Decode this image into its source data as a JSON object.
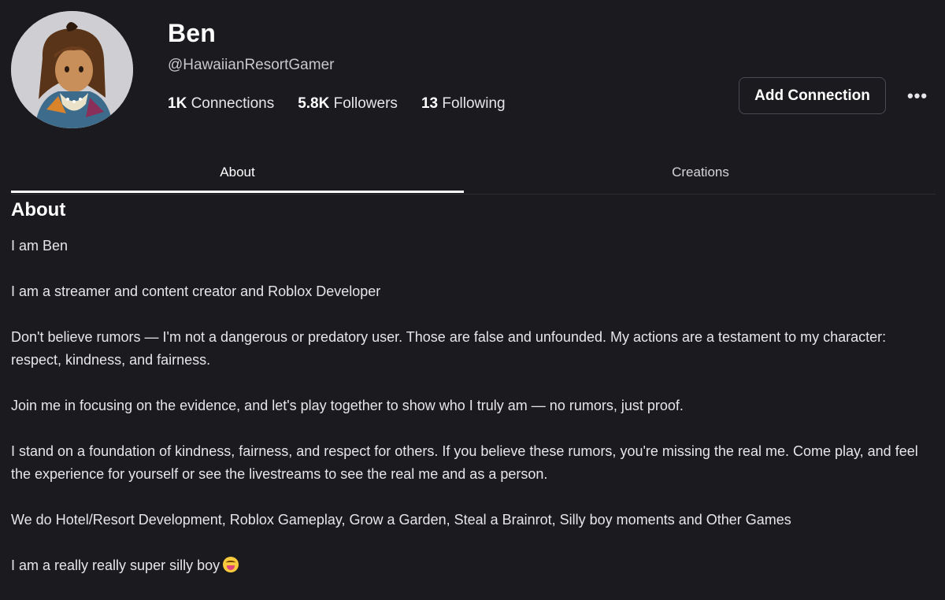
{
  "profile": {
    "display_name": "Ben",
    "username": "@HawaiianResortGamer"
  },
  "stats": [
    {
      "count": "1K",
      "label": "Connections"
    },
    {
      "count": "5.8K",
      "label": "Followers"
    },
    {
      "count": "13",
      "label": "Following"
    }
  ],
  "actions": {
    "add_connection": "Add Connection",
    "more": "•••"
  },
  "tabs": [
    {
      "label": "About",
      "active": true
    },
    {
      "label": "Creations",
      "active": false
    }
  ],
  "about": {
    "heading": "About",
    "paragraphs": [
      "I am Ben",
      "I am a streamer and content creator and Roblox Developer",
      "Don't believe rumors — I'm not a dangerous or predatory user. Those are false and unfounded. My actions are a testament to my character: respect, kindness, and fairness.",
      "Join me in focusing on the evidence, and let's play together to show who I truly am — no rumors, just proof.",
      "I stand on a foundation of kindness, fairness, and respect for others. If you believe these rumors, you're missing the real me. Come play, and feel the experience for yourself or see the livestreams to see the real me and as a person.",
      "We do Hotel/Resort Development, Roblox Gameplay, Grow a Garden, Steal a Brainrot, Silly boy moments and Other Games",
      "I am a really really super silly boy"
    ],
    "last_emoji": "grinning-tongue-emoji"
  },
  "colors": {
    "background": "#1b1a1f",
    "text": "#f2f2f4",
    "muted": "#c8c8cc",
    "border": "#4a4a52"
  }
}
